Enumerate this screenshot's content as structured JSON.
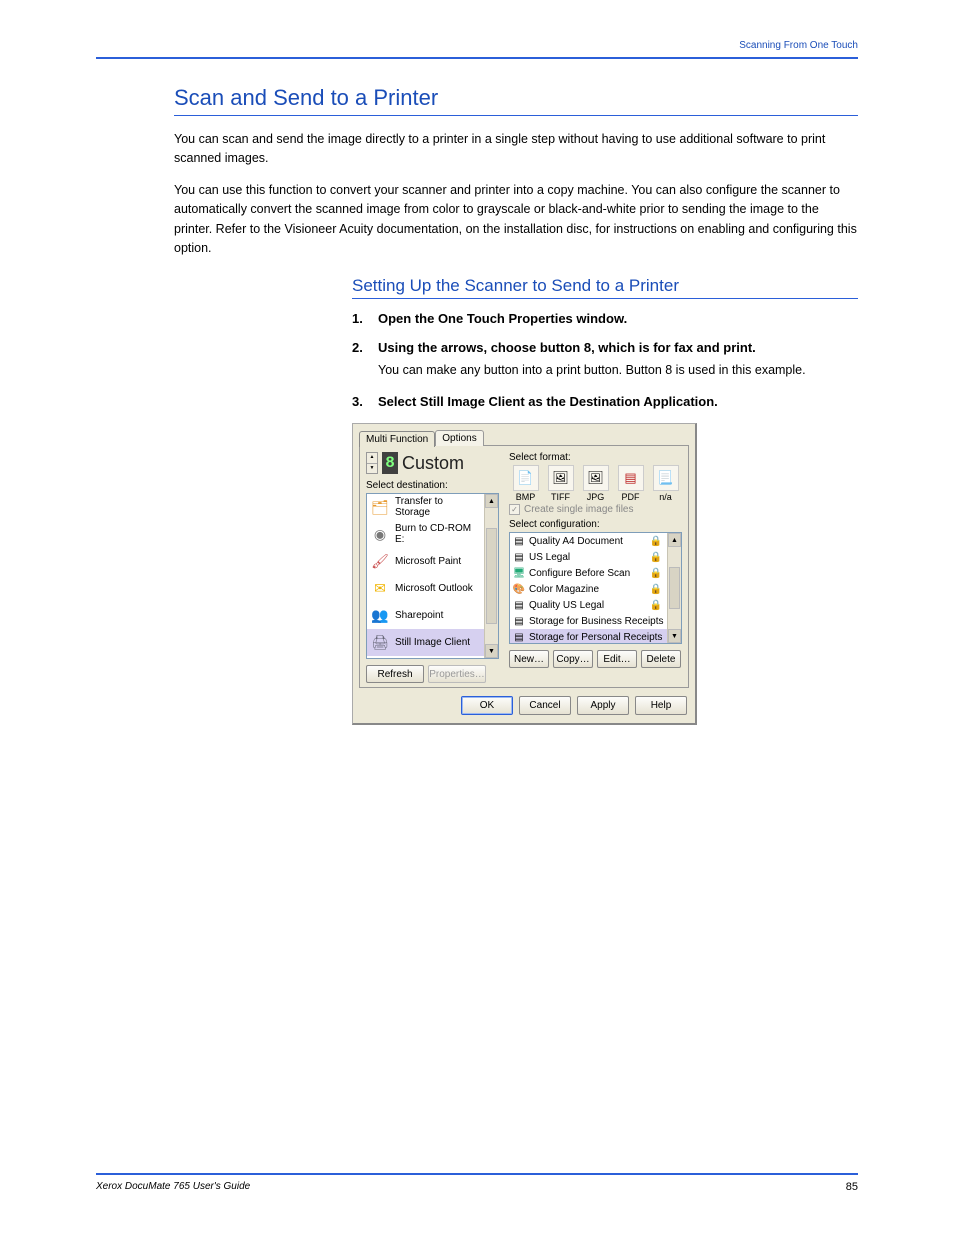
{
  "header": {
    "right": "Scanning From One Touch"
  },
  "section": {
    "title": "Scan and Send to a Printer",
    "p1": "You can scan and send the image directly to a printer in a single step without having to use additional software to print scanned images.",
    "p2": "You can use this function to convert your scanner and printer into a copy machine. You can also configure the scanner to automatically convert the scanned image from color to grayscale or black-and-white prior to sending the image to the printer. Refer to the Visioneer Acuity documentation, on the installation disc, for instructions on enabling and configuring this option."
  },
  "subsection": {
    "title": "Setting Up the Scanner to Send to a Printer",
    "steps": [
      {
        "num": "1.",
        "body": "Open the One Touch Properties window."
      },
      {
        "num": "2.",
        "body": "Using the arrows, choose button 8, which is for fax and print.",
        "sub": "You can make any button into a print button. Button 8 is used in this example."
      },
      {
        "num": "3.",
        "body": "Select Still Image Client as the Destination Application."
      }
    ]
  },
  "dialog": {
    "tabs": [
      "Multi Function",
      "Options"
    ],
    "activeTab": 0,
    "buttonNumber": "8",
    "buttonName": "Custom",
    "destLabel": "Select destination:",
    "destinations": [
      {
        "label": "Transfer to Storage",
        "iconColor": "#e79a2f"
      },
      {
        "label": "Burn to CD-ROM   E:",
        "iconColor": "#9aa0a6"
      },
      {
        "label": "Microsoft Paint",
        "iconColor": "#c94f4f"
      },
      {
        "label": "Microsoft Outlook",
        "iconColor": "#f0b400"
      },
      {
        "label": "Sharepoint",
        "iconColor": "#5b9bd5"
      },
      {
        "label": "Still Image Client",
        "iconColor": "#7a8aa0",
        "selected": true
      }
    ],
    "btnRefresh": "Refresh",
    "btnProperties": "Properties…",
    "formatLabel": "Select format:",
    "formats": [
      "BMP",
      "TIFF",
      "JPG",
      "PDF",
      "n/a"
    ],
    "chkCreateSingle": "Create single image files",
    "configLabel": "Select configuration:",
    "configs": [
      {
        "label": "Quality A4 Document",
        "lock": true
      },
      {
        "label": "US Legal",
        "lock": true
      },
      {
        "label": "Configure Before Scan",
        "lock": true,
        "color": true
      },
      {
        "label": "Color Magazine",
        "lock": true,
        "colorball": true
      },
      {
        "label": "Quality US Legal",
        "lock": true
      },
      {
        "label": "Storage for Business Receipts",
        "lock": false
      },
      {
        "label": "Storage for Personal Receipts",
        "lock": false,
        "selected": true
      }
    ],
    "btnNew": "New…",
    "btnCopy": "Copy…",
    "btnEdit": "Edit…",
    "btnDelete": "Delete",
    "btnOK": "OK",
    "btnCancel": "Cancel",
    "btnApply": "Apply",
    "btnHelp": "Help"
  },
  "footer": {
    "left": "Xerox DocuMate 765 User's Guide",
    "page": "85"
  }
}
